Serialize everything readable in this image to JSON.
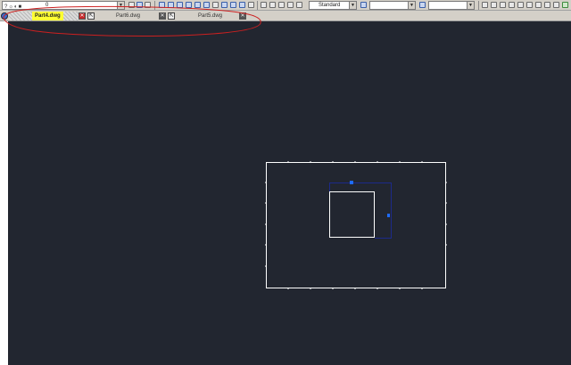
{
  "toolbar": {
    "layer_value": "0",
    "text_style": "Standard"
  },
  "tabs": [
    {
      "label": "Part4.dwg",
      "active": true
    },
    {
      "label": "Part6.dwg",
      "active": false
    },
    {
      "label": "Part5.dwg",
      "active": false
    }
  ],
  "tab_close_glyph": "✕",
  "tab_pin_glyph": "⇱",
  "colors": {
    "canvas_bg": "#222630",
    "geometry": "#ffffff",
    "highlight_tab": "#ffff33",
    "annotation_ellipse": "#cc2020",
    "grip": "#1e6bff",
    "selection": "#1c2a8a"
  },
  "icons": [
    "question-icon",
    "lightbulb-icon",
    "sun-icon",
    "lock-icon",
    "layer-color-icon",
    "save-icon",
    "print-icon",
    "plot-icon",
    "pan-icon",
    "zoom-icon",
    "undo-icon",
    "redo-icon",
    "match-properties-icon",
    "line-icon",
    "polyline-icon",
    "circle-icon",
    "rectangle-icon",
    "arc-icon",
    "hatch-icon"
  ]
}
